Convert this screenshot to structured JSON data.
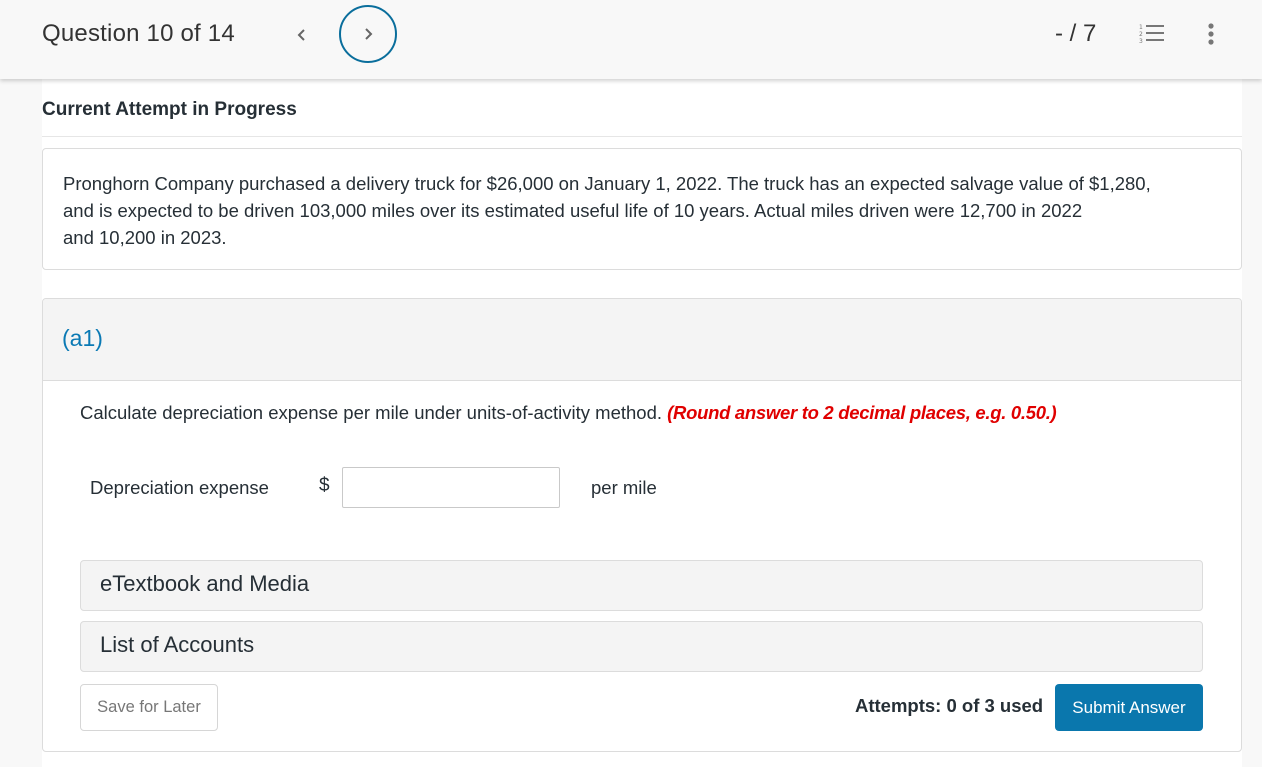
{
  "header": {
    "question_position": "Question 10 of 14",
    "prev_icon": "chevron-left-icon",
    "next_icon": "chevron-right-icon",
    "score": "- / 7",
    "question_list_icon": "numbered-list-icon",
    "more_icon": "more-vertical-icon",
    "accent_color": "#0a6e9c"
  },
  "attempt": {
    "heading": "Current Attempt in Progress"
  },
  "problem": {
    "lines": [
      "Pronghorn Company purchased a delivery truck for $26,000 on January 1, 2022. The truck has an expected salvage value of $1,280,",
      "and is expected to be driven 103,000 miles over its estimated useful life of 10 years. Actual miles driven were 12,700 in 2022",
      "and 10,200 in 2023."
    ]
  },
  "part": {
    "label": "(a1)",
    "instruction": "Calculate depreciation expense per mile under units-of-activity method.",
    "hint": "(Round answer to 2 decimal places, e.g. 0.50.)",
    "hint_color": "#e00000",
    "field_label": "Depreciation expense",
    "currency_symbol": "$",
    "answer_value": "",
    "answer_placeholder": "",
    "unit_label": "per mile"
  },
  "resources": [
    {
      "label": "eTextbook and Media"
    },
    {
      "label": "List of Accounts"
    }
  ],
  "footer": {
    "save_label": "Save for Later",
    "attempts_text": "Attempts: 0 of 3 used",
    "submit_label": "Submit Answer",
    "submit_color": "#0a77ad"
  }
}
